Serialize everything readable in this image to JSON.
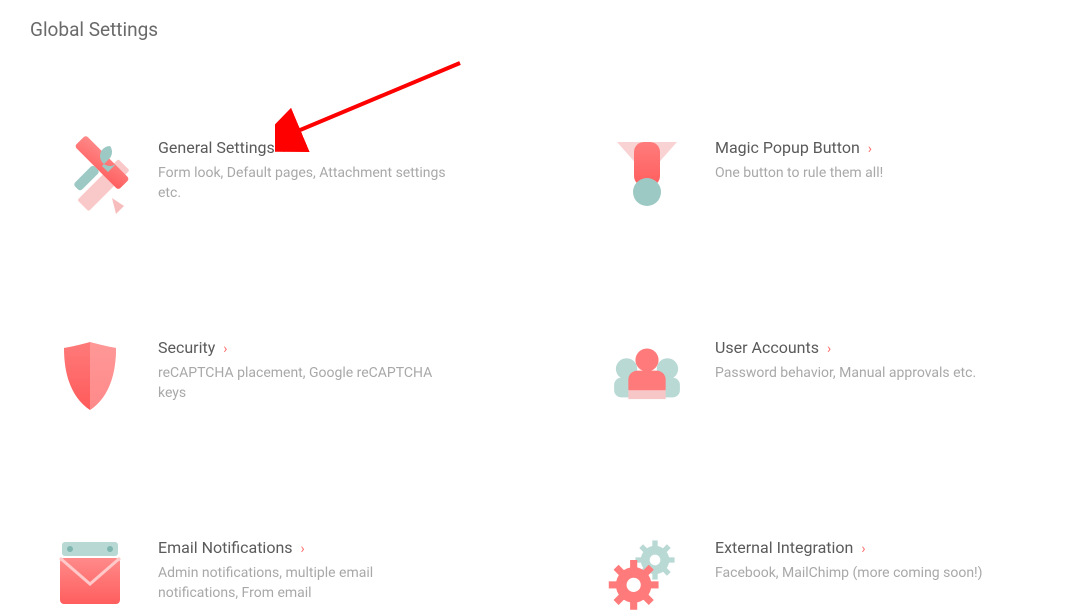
{
  "page_title": "Global Settings",
  "colors": {
    "accent": "#ff6b6b",
    "muted": "#a8a8a8"
  },
  "cards": [
    {
      "id": "general-settings",
      "title": "General Settings",
      "desc": "Form look, Default pages, Attachment settings etc.",
      "icon": "tools-icon"
    },
    {
      "id": "magic-popup-button",
      "title": "Magic Popup Button",
      "desc": "One button to rule them all!",
      "icon": "magic-popup-icon"
    },
    {
      "id": "security",
      "title": "Security",
      "desc": "reCAPTCHA placement, Google reCAPTCHA keys",
      "icon": "shield-icon"
    },
    {
      "id": "user-accounts",
      "title": "User Accounts",
      "desc": "Password behavior, Manual approvals etc.",
      "icon": "users-icon"
    },
    {
      "id": "email-notifications",
      "title": "Email Notifications",
      "desc": "Admin notifications, multiple email notifications, From email",
      "icon": "envelope-icon"
    },
    {
      "id": "external-integration",
      "title": "External Integration",
      "desc": "Facebook, MailChimp (more coming soon!)",
      "icon": "gears-icon"
    }
  ],
  "annotation": {
    "type": "arrow",
    "target": "general-settings"
  }
}
